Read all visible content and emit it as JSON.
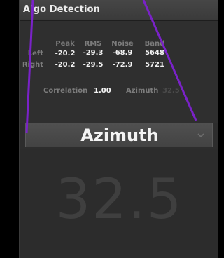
{
  "panel": {
    "title": "Algo Detection"
  },
  "table": {
    "headers": [
      "Peak",
      "RMS",
      "Noise",
      "Band"
    ],
    "rows": [
      {
        "label": "Left",
        "values": [
          "-20.2",
          "-29.3",
          "-68.9",
          "5648"
        ]
      },
      {
        "label": "Right",
        "values": [
          "-20.2",
          "-29.5",
          "-72.9",
          "5721"
        ]
      }
    ],
    "correlation_label": "Correlation",
    "correlation_value": "1.00",
    "azimuth_label": "Azimuth",
    "azimuth_value": "32.5"
  },
  "selector": {
    "selected": "Azimuth",
    "arrow_icon": "chevron-down-icon"
  },
  "readout": {
    "value": "32.5"
  },
  "colors": {
    "annotation_line": "#7a22c8",
    "panel_bg": "#2d2d2d",
    "header_bg": "#404040",
    "big_value": "#3f3f3f"
  }
}
